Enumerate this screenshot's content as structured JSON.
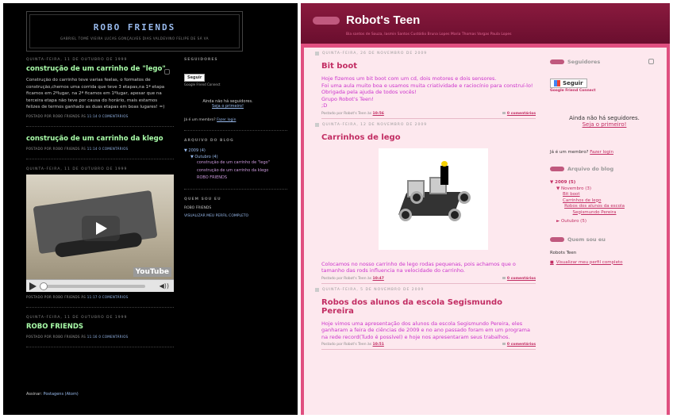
{
  "left": {
    "title": "ROBO FRIENDS",
    "description": "GABRIEL TOMÉ VIEIRA LUCAS GONÇALVES DIAS VALDEVINO FELIPE DE SÁ VA",
    "posts": [
      {
        "date": "QUINTA-FEIRA, 11 DE OUTUBRO DE 1999",
        "title": "construção de um carrinho de \"lego\"",
        "body": "Construção do carrinho teve varias feelas, o formatos de construção,chemos uma corrida que teve 3 etapas,na 1ª etapa ficamos em 2ºlugar, na 2ª ficamos em 1ºlugar, apesar que na terceira etapa não teve por causa do horário, mais estamos felizes de termos ganhado as duas etapas em boas lugares! =)",
        "footer_pre": "POSTADO POR ROBO FRIENDS ÀS",
        "time": "11:14",
        "comments": "0 COMENTÁRIOS"
      },
      {
        "title": "construção de um carrinho da klego",
        "footer_pre": "POSTADO POR ROBO FRIENDS ÀS",
        "time": "11:14",
        "comments": "0 COMENTÁRIOS"
      },
      {
        "date": "QUINTA-FEIRA, 11 DE OUTUBRO DE 1999",
        "video_logo": "YouTube",
        "footer_pre": "POSTADO POR ROBO FRIENDS ÀS",
        "time": "11:17",
        "comments": "0 COMENTÁRIOS"
      },
      {
        "date": "QUINTA-FEIRA, 11 DE OUTUBRO DE 1999",
        "title": "ROBO FRIENDS",
        "footer_pre": "POSTADO POR ROBO FRIENDS ÀS",
        "time": "11:16",
        "comments": "0 COMENTÁRIOS"
      }
    ],
    "atom_pre": "Assinar:",
    "atom_link": "Postagens (Atom)",
    "sidebar": {
      "followers_heading": "SEGUIDORES",
      "follow_btn": "Seguir",
      "gfc": "Google Friend Connect",
      "no_followers": "Ainda não há seguidores.",
      "be_first": "Seja o primeiro!",
      "member_q": "Já é um membro?",
      "login": "Fazer login",
      "archive_heading": "ARQUIVO DO BLOG",
      "year": "▼ 2009 (4)",
      "month": "▼ Outubro (4)",
      "items": [
        "construção de um carrinho de \"lego\"",
        "construção de um carrinho da klego",
        "ROBO FRIENDS"
      ],
      "about_heading": "QUEM SOU EU",
      "about_name": "ROBO FRIENDS",
      "profile_link": "VISUALIZAR MEU PERFIL COMPLETO"
    }
  },
  "right": {
    "title": "Robot's Teen",
    "description": "Bia santos de Souza, Iasmin Santos Custódio Bruna Lopes Maria Thomas Vargas Paula Lopes",
    "posts": [
      {
        "date": "QUINTA-FEIRA, 26 DE NOVEMBRO DE 2009",
        "title": "Bit boot",
        "lines": [
          "Hoje fizemos um bit boot com um cd, dois motores e dois sensores.",
          "Foi uma aula muito boa e usamos muita criatividade e raciocínio para construí-lo!",
          "Obrigada pela ajuda de todos vocês!",
          "Grupo Robot's Teen!",
          ";D"
        ],
        "footer_pre": "Postado por Robot's Teen às",
        "time": "10:56",
        "comments": "0 comentários"
      },
      {
        "date": "QUINTA-FEIRA, 12 DE NOVEMBRO DE 2009",
        "title": "Carrinhos de lego",
        "body": "Colocamos no nosso carrinho de lego rodas pequenas, pois achamos que o tamanho das rods influencia na velocidade do carrinho.",
        "footer_pre": "Postado por Robot's Teen às",
        "time": "10:47",
        "comments": "0 comentários"
      },
      {
        "date": "QUINTA-FEIRA, 5 DE NOVEMBRO DE 2009",
        "title": "Robos dos alunos da escola Segismundo Pereira",
        "body": "Hoje vimos uma apresentação dos alunos da escola Segismundo Pereira, eles ganharam a feira de ciências de 2009 e no ano passado foram em um programa na rede record(Tudo é possível) e hoje nos apresentaram seus trabalhos.",
        "footer_pre": "Postado por Robot's Teen às",
        "time": "10:51",
        "comments": "0 comentários"
      }
    ],
    "sidebar": {
      "followers_heading": "Seguidores",
      "follow_btn": "Seguir",
      "gfc": "Google Friend Connect",
      "no_followers": "Ainda não há seguidores.",
      "be_first": "Seja o primeiro!",
      "member_q": "Já é um membro?",
      "login": "Fazer login",
      "archive_heading": "Arquivo do blog",
      "year": "▼ 2009 (5)",
      "month": "▼ Novembro (3)",
      "items": [
        "Bit boot",
        "Carrinhos de lego",
        "Robos dos alunos da escola Segismundo Pereira"
      ],
      "oct": "► Outubro (5)",
      "about_heading": "Quem sou eu",
      "about_name": "Robots Teen",
      "profile_link": "Visualizar meu perfil completo"
    }
  }
}
